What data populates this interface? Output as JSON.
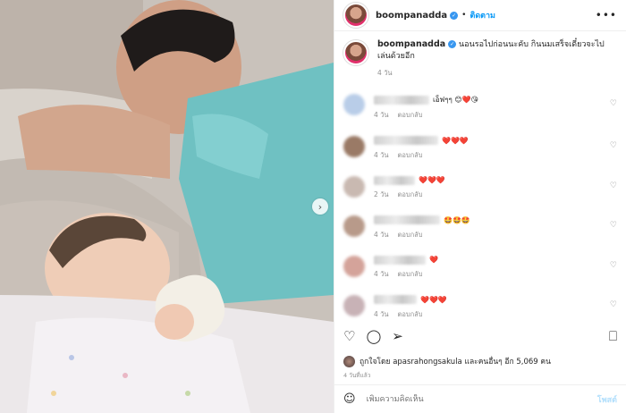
{
  "colors": {
    "link": "#0095f6",
    "verified": "#3897f0",
    "muted": "#8e8e8e",
    "heart": "#ed4956"
  },
  "header": {
    "username": "boompanadda",
    "dot": "•",
    "follow_label": "ติดตาม",
    "more_icon": "more-horizontal-icon"
  },
  "caption": {
    "username": "boompanadda",
    "text": "นอนรอไปก่อนนะคับ กินนมเสร็จเดี๋ยวจะไปเล่นด้วยอีก",
    "age": "4 วัน"
  },
  "comments": [
    {
      "emojis": "เอ็ฟๆๆ 😊❤️😘",
      "age": "4 วัน",
      "reply": "ตอบกลับ",
      "av": "#b9cde8"
    },
    {
      "emojis": "❤️❤️❤️",
      "age": "4 วัน",
      "reply": "ตอบกลับ",
      "av": "#9a7a66"
    },
    {
      "emojis": "❤️❤️❤️",
      "age": "2 วัน",
      "reply": "ตอบกลับ",
      "av": "#c9b9b1"
    },
    {
      "emojis": "🤩🤩🤩",
      "age": "4 วัน",
      "reply": "ตอบกลับ",
      "av": "#b89a8a"
    },
    {
      "emojis": "❤️",
      "age": "4 วัน",
      "reply": "ตอบกลับ",
      "av": "#d4a39a"
    },
    {
      "emojis": "❤️❤️❤️",
      "age": "4 วัน",
      "reply": "ตอบกลับ",
      "av": "#c8b2b6"
    }
  ],
  "likes": {
    "text": "ถูกใจโดย apasrahongsakula และคนอื่นๆ อีก 5,069 คน"
  },
  "post_time": "4 วันที่แล้ว",
  "add_comment": {
    "placeholder": "เพิ่มความคิดเห็น",
    "post_label": "โพสต์"
  }
}
